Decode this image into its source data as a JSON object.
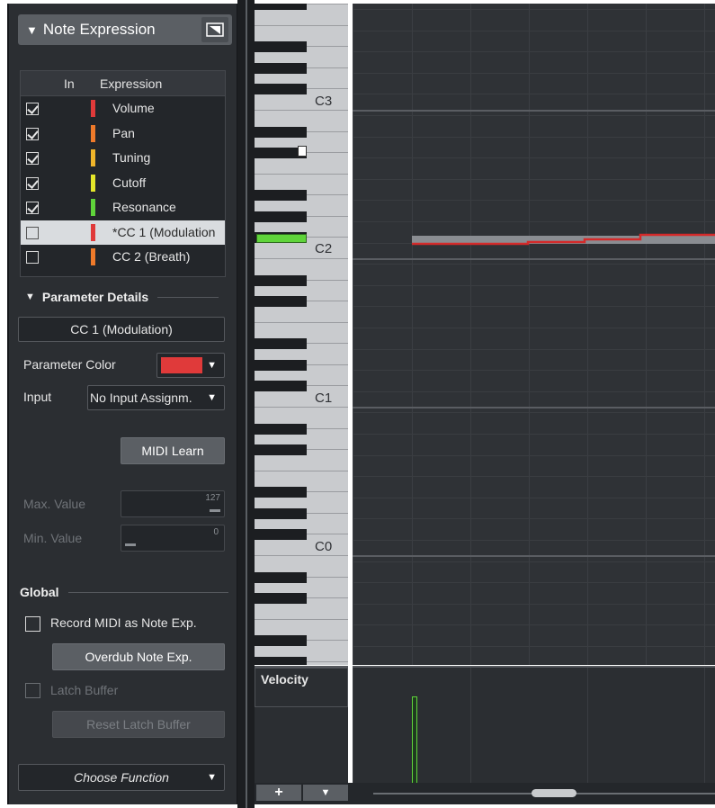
{
  "inspector": {
    "section_title": "Note Expression",
    "table": {
      "col_in": "In",
      "col_expression": "Expression",
      "rows": [
        {
          "checked": true,
          "color": "#e03a3a",
          "name": "Volume"
        },
        {
          "checked": true,
          "color": "#ef7a2a",
          "name": "Pan"
        },
        {
          "checked": true,
          "color": "#f0b52a",
          "name": "Tuning"
        },
        {
          "checked": true,
          "color": "#e4e62a",
          "name": "Cutoff"
        },
        {
          "checked": true,
          "color": "#5fd43a",
          "name": "Resonance"
        },
        {
          "checked": false,
          "color": "#e03a3a",
          "name": "*CC 1  (Modulation",
          "selected": true
        },
        {
          "checked": false,
          "color": "#ef7a2a",
          "name": "CC 2  (Breath)"
        }
      ]
    },
    "parameter_details": {
      "header": "Parameter Details",
      "parameter_name": "CC 1  (Modulation)",
      "color_label": "Parameter Color",
      "color_value": "#e03a3a",
      "input_label": "Input",
      "input_value": "No Input Assignm.",
      "midi_learn": "MIDI Learn",
      "max_label": "Max. Value",
      "max_value": "127",
      "min_label": "Min. Value",
      "min_value": "0"
    },
    "global": {
      "header": "Global",
      "record_midi_label": "Record MIDI as Note Exp.",
      "overdub_button": "Overdub Note Exp.",
      "latch_label": "Latch Buffer",
      "reset_latch_button": "Reset Latch Buffer"
    },
    "choose_function": "Choose Function"
  },
  "keyboard": {
    "labels": [
      "C3",
      "C2",
      "C1",
      "C0"
    ]
  },
  "velocity": {
    "label": "Velocity"
  },
  "bottom": {
    "add_symbol": "+",
    "menu_symbol": "▼"
  },
  "colors": {
    "accent_note": "#8a8d92",
    "modulation_curve": "#d42a2a",
    "selected_key": "#5fd43a"
  }
}
